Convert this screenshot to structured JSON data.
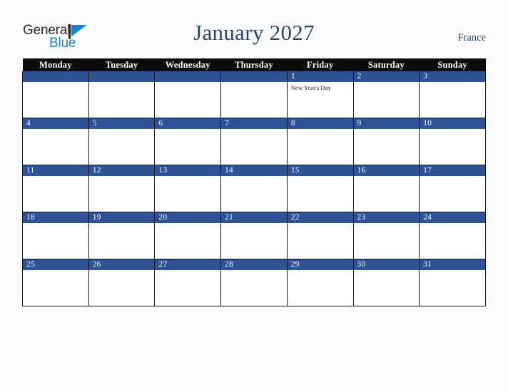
{
  "brand": {
    "name_part1": "General",
    "name_part2": "Blue",
    "triangle_color": "#1b84c6"
  },
  "header": {
    "title": "January 2027",
    "country": "France"
  },
  "theme": {
    "accent_blue": "#2e5294",
    "header_black": "#0b0b0b",
    "title_navy": "#2c4470",
    "page_background": "#fbfcfd"
  },
  "calendar": {
    "month": "January",
    "year": "2027",
    "weekday_headers": [
      "Monday",
      "Tuesday",
      "Wednesday",
      "Thursday",
      "Friday",
      "Saturday",
      "Sunday"
    ],
    "weeks": [
      [
        {
          "date": "",
          "events": []
        },
        {
          "date": "",
          "events": []
        },
        {
          "date": "",
          "events": []
        },
        {
          "date": "",
          "events": []
        },
        {
          "date": "1",
          "events": [
            "New Year's Day"
          ]
        },
        {
          "date": "2",
          "events": []
        },
        {
          "date": "3",
          "events": []
        }
      ],
      [
        {
          "date": "4",
          "events": []
        },
        {
          "date": "5",
          "events": []
        },
        {
          "date": "6",
          "events": []
        },
        {
          "date": "7",
          "events": []
        },
        {
          "date": "8",
          "events": []
        },
        {
          "date": "9",
          "events": []
        },
        {
          "date": "10",
          "events": []
        }
      ],
      [
        {
          "date": "11",
          "events": []
        },
        {
          "date": "12",
          "events": []
        },
        {
          "date": "13",
          "events": []
        },
        {
          "date": "14",
          "events": []
        },
        {
          "date": "15",
          "events": []
        },
        {
          "date": "16",
          "events": []
        },
        {
          "date": "17",
          "events": []
        }
      ],
      [
        {
          "date": "18",
          "events": []
        },
        {
          "date": "19",
          "events": []
        },
        {
          "date": "20",
          "events": []
        },
        {
          "date": "21",
          "events": []
        },
        {
          "date": "22",
          "events": []
        },
        {
          "date": "23",
          "events": []
        },
        {
          "date": "24",
          "events": []
        }
      ],
      [
        {
          "date": "25",
          "events": []
        },
        {
          "date": "26",
          "events": []
        },
        {
          "date": "27",
          "events": []
        },
        {
          "date": "28",
          "events": []
        },
        {
          "date": "29",
          "events": []
        },
        {
          "date": "30",
          "events": []
        },
        {
          "date": "31",
          "events": []
        }
      ]
    ]
  }
}
